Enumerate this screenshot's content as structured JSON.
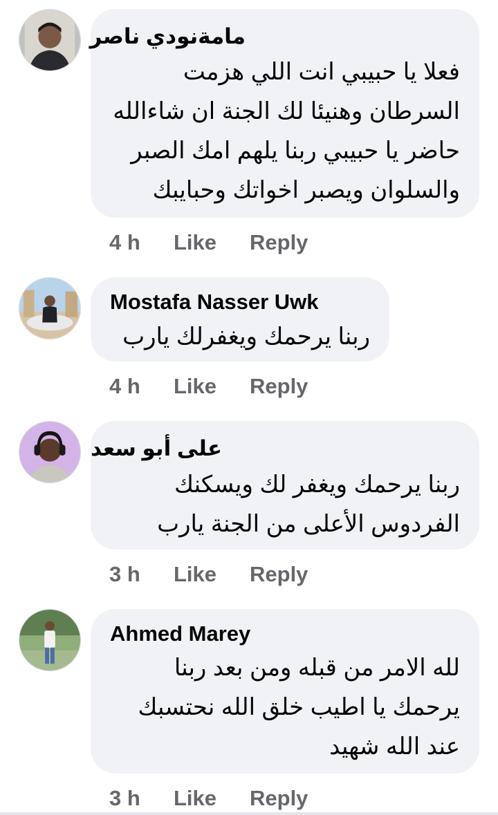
{
  "comments": [
    {
      "author": "مامةنودي ناصر",
      "text_lines": [
        "فعلا يا حبيبي انت اللي هزمت",
        "السرطان وهنيئا لك الجنة ان شاءالله",
        "حاضر يا حبيبي ربنا يلهم امك الصبر",
        "والسلوان ويصبر اخواتك وحبايبك"
      ],
      "time": "4 h",
      "like_label": "Like",
      "reply_label": "Reply"
    },
    {
      "author": "Mostafa Nasser Uwk",
      "text_lines": [
        "ربنا يرحمك ويغفرلك يارب"
      ],
      "time": "4 h",
      "like_label": "Like",
      "reply_label": "Reply"
    },
    {
      "author": "على أبو سعد",
      "text_lines": [
        "ربنا يرحمك ويغفر لك ويسكنك",
        "الفردوس الأعلى من الجنة يارب"
      ],
      "time": "3 h",
      "like_label": "Like",
      "reply_label": "Reply"
    },
    {
      "author": "Ahmed Marey",
      "text_lines": [
        "لله الامر من قبله ومن بعد ربنا",
        "يرحمك يا اطيب خلق الله نحتسبك",
        "عند الله شهيد"
      ],
      "time": "3 h",
      "like_label": "Like",
      "reply_label": "Reply"
    }
  ],
  "colors": {
    "bubble_background": "#f0f2f5",
    "secondary_text": "#65676b",
    "primary_text": "#050505"
  },
  "icons": [
    "avatar-photo"
  ]
}
